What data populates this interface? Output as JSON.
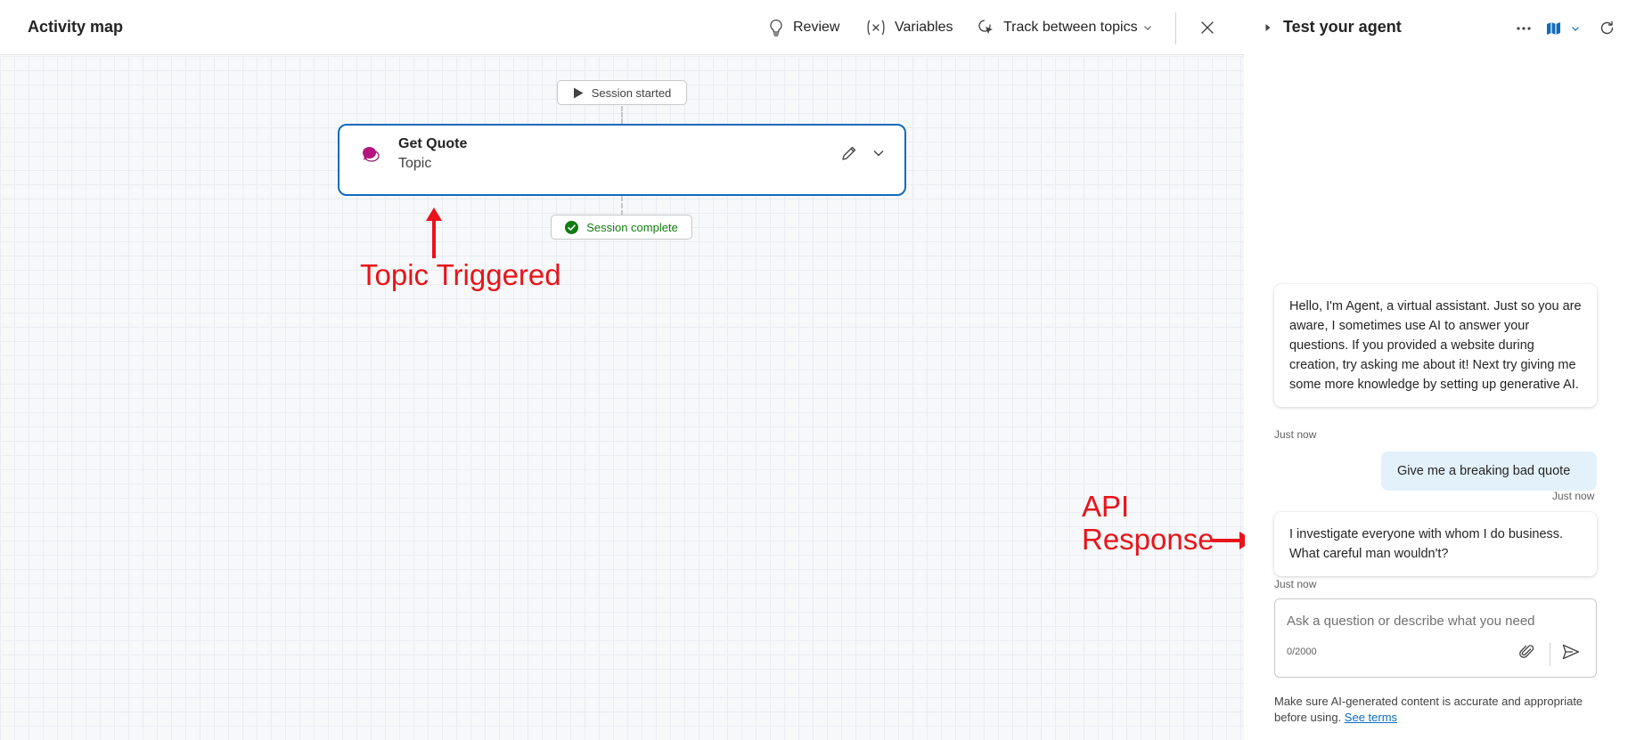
{
  "activity_map": {
    "title": "Activity map",
    "review_label": "Review",
    "variables_label": "Variables",
    "track_label": "Track between topics"
  },
  "canvas": {
    "session_started": "Session started",
    "session_complete": "Session complete",
    "topic_card": {
      "title": "Get Quote",
      "subtitle": "Topic"
    }
  },
  "annotations": {
    "topic_triggered": "Topic Triggered",
    "api_response_line1": "API",
    "api_response_line2": "Response"
  },
  "test_panel": {
    "title": "Test your agent",
    "messages": [
      {
        "role": "agent",
        "text": "Hello, I'm Agent, a virtual assistant. Just so you are aware, I sometimes use AI to answer your questions. If you provided a website during creation, try asking me about it! Next try giving me some more knowledge by setting up generative AI.",
        "time": "Just now"
      },
      {
        "role": "user",
        "text": "Give me a breaking bad quote",
        "time": "Just now"
      },
      {
        "role": "agent",
        "text": "I investigate everyone with whom I do business. What careful man wouldn't?",
        "time": "Just now"
      }
    ],
    "composer": {
      "placeholder": "Ask a question or describe what you need",
      "char_count": "0/2000"
    },
    "disclaimer_text": "Make sure AI-generated content is accurate and appropriate before using.",
    "see_terms_label": "See terms"
  },
  "colors": {
    "accent": "#0f6cbd",
    "annotation": "#e8141a",
    "success": "#107c10",
    "user_bubble": "#e3f1fb"
  }
}
